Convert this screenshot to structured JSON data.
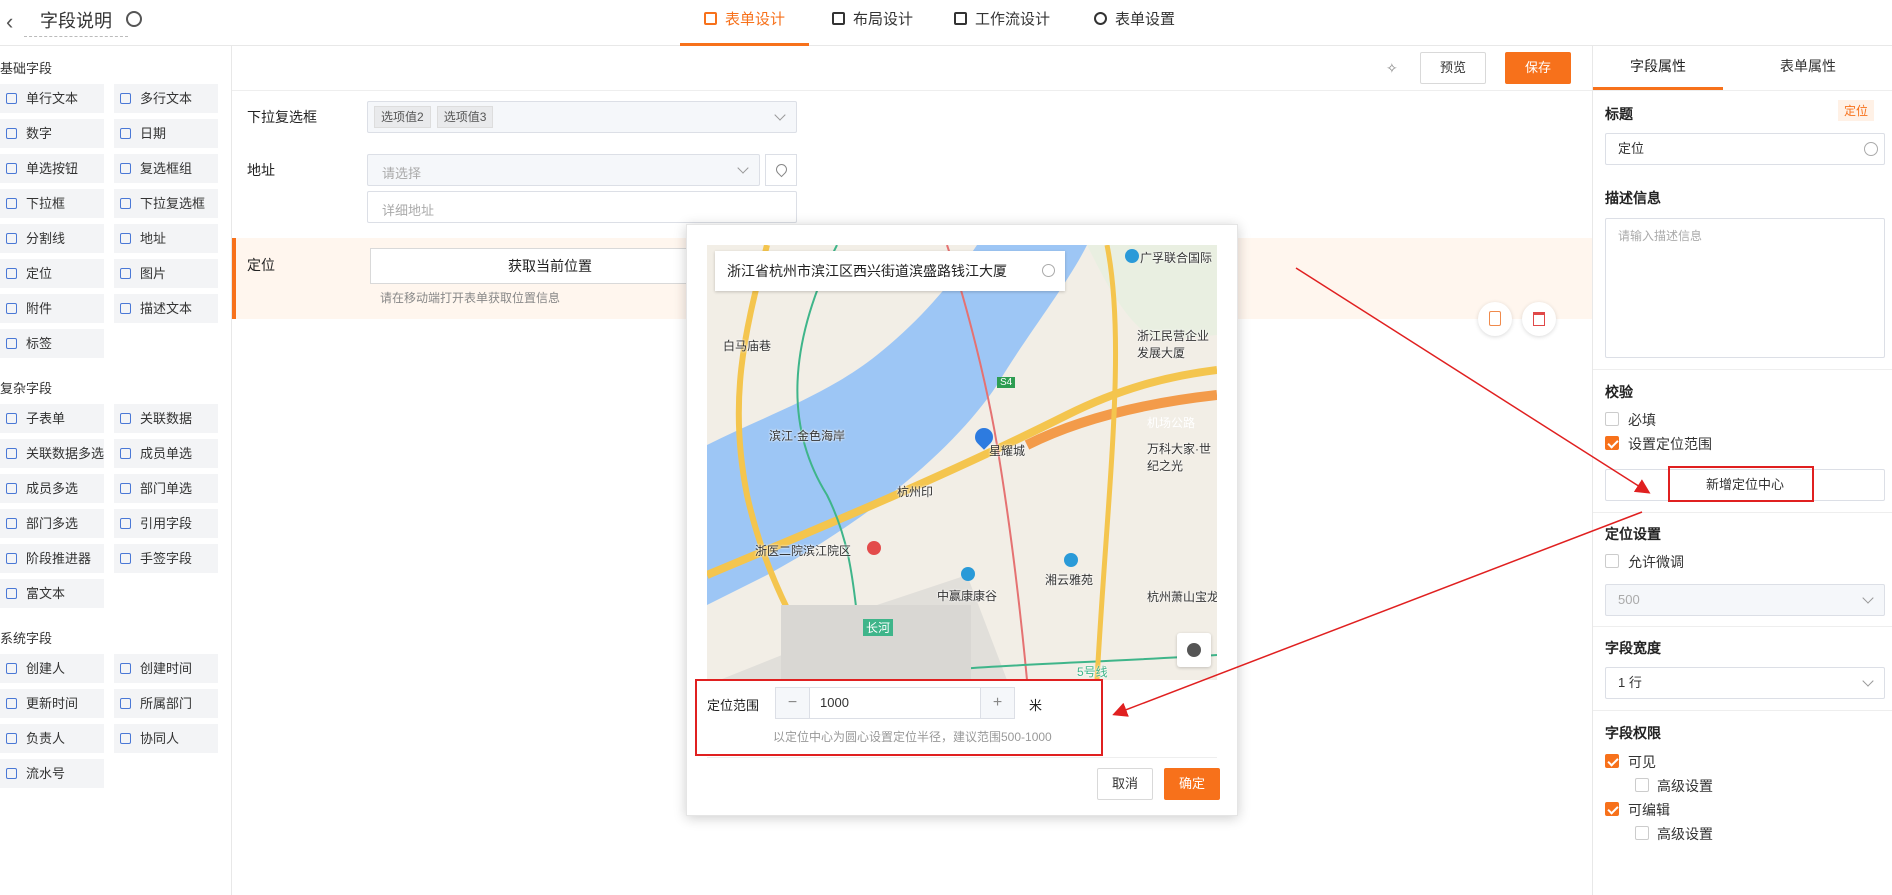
{
  "header": {
    "back_icon": "chevron-left-icon",
    "title": "字段说明",
    "tabs": [
      {
        "label": "表单设计",
        "active": true
      },
      {
        "label": "布局设计",
        "active": false
      },
      {
        "label": "工作流设计",
        "active": false
      },
      {
        "label": "表单设置",
        "active": false
      }
    ]
  },
  "sidebar": {
    "basic_title": "基础字段",
    "basic": [
      "单行文本",
      "多行文本",
      "数字",
      "日期",
      "单选按钮",
      "复选框组",
      "下拉框",
      "下拉复选框",
      "分割线",
      "地址",
      "定位",
      "图片",
      "附件",
      "描述文本",
      "标签"
    ],
    "complex_title": "复杂字段",
    "complex": [
      "子表单",
      "关联数据",
      "关联数据多选",
      "成员单选",
      "成员多选",
      "部门单选",
      "部门多选",
      "引用字段",
      "阶段推进器",
      "手签字段",
      "富文本"
    ],
    "system_title": "系统字段",
    "system": [
      "创建人",
      "创建时间",
      "更新时间",
      "所属部门",
      "负责人",
      "协同人",
      "流水号"
    ]
  },
  "toolbar": {
    "preview_label": "预览",
    "save_label": "保存"
  },
  "form": {
    "dropdown_multi": {
      "label": "下拉复选框",
      "chips": [
        "选项值2",
        "选项值3"
      ]
    },
    "address": {
      "label": "地址",
      "placeholder": "请选择",
      "detail_placeholder": "详细地址"
    },
    "location": {
      "label": "定位",
      "button": "获取当前位置",
      "hint": "请在移动端打开表单获取位置信息"
    }
  },
  "modal": {
    "search_value": "浙江省杭州市滨江区西兴街道滨盛路钱江大厦",
    "map_labels": [
      "广孚联合国际",
      "白马庙巷",
      "滨江·金色海岸",
      "星耀城",
      "杭州印",
      "浙江民营企业发展大厦",
      "万科大家·世纪之光",
      "机场公路",
      "浙医二院滨江院区",
      "中赢康康谷",
      "湘云雅苑",
      "杭州萧山宝龙",
      "长河",
      "5号线",
      "S4"
    ],
    "range_label": "定位范围",
    "range_value": "1000",
    "range_unit": "米",
    "range_hint": "以定位中心为圆心设置定位半径，建议范围500-1000",
    "cancel_label": "取消",
    "confirm_label": "确定"
  },
  "props": {
    "tabs": [
      "字段属性",
      "表单属性"
    ],
    "title_label": "标题",
    "title_badge": "定位",
    "title_value": "定位",
    "desc_label": "描述信息",
    "desc_placeholder": "请输入描述信息",
    "validate_label": "校验",
    "required_label": "必填",
    "range_check_label": "设置定位范围",
    "add_center_label": "新增定位中心",
    "loc_settings_label": "定位设置",
    "allow_adjust_label": "允许微调",
    "adjust_value": "500",
    "width_label": "字段宽度",
    "width_value": "1 行",
    "perm_label": "字段权限",
    "visible_label": "可见",
    "advanced1_label": "高级设置",
    "editable_label": "可编辑",
    "advanced2_label": "高级设置"
  },
  "colors": {
    "accent": "#f7711b",
    "annotation": "#e02020",
    "icon_blue": "#4a78d6"
  }
}
